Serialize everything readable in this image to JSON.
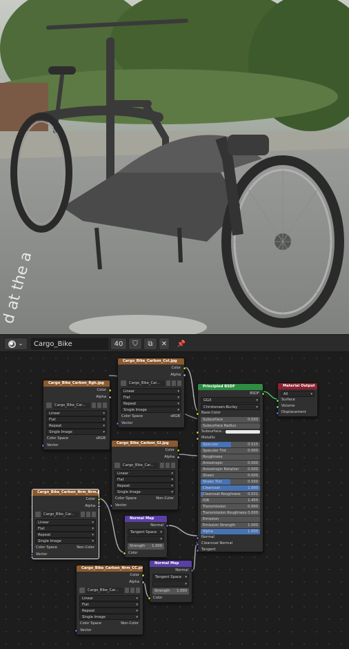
{
  "header": {
    "editor_icon": "shader-editor-icon",
    "material_name": "Cargo_Bike",
    "user_count": "40"
  },
  "viewport": {
    "overlay_text": "d at the a"
  },
  "colors": {
    "texture_header": "#8c5a30",
    "vector_header": "#5b3fa6",
    "shader_header": "#2f8c43",
    "output_header": "#8c2230",
    "color_socket": "#c7c729",
    "float_socket": "#a1a1a1",
    "vector_socket": "#6363c7",
    "shader_socket": "#63c763"
  },
  "tex": {
    "out_color": "Color",
    "out_alpha": "Alpha",
    "opt_interp": "Linear",
    "opt_proj": "Flat",
    "opt_ext": "Repeat",
    "opt_src": "Single Image",
    "cs_label": "Color Space",
    "vector": "Vector",
    "image_name": "Cargo_Bike_Car..."
  },
  "nodes": {
    "rough": {
      "title": "Cargo_Bike_Carbon_Rgh.jpg",
      "cs": "sRGB"
    },
    "col": {
      "title": "Cargo_Bike_Carbon_Col.jpg",
      "cs": "sRGB"
    },
    "gloss": {
      "title": "Cargo_Bike_Carbon_Gl.jpg",
      "cs": "Non-Color"
    },
    "normal": {
      "title": "Cargo_Bike_Carbon_Nrm_Nrm.jpg",
      "cs": "Non-Color"
    },
    "norm2": {
      "title": "Cargo_Bike_Carbon_Nrm_CC.png",
      "cs": "Non-Color"
    },
    "nmap1": {
      "title": "Normal Map",
      "out": "Normal",
      "space": "Tangent Space",
      "strength": "Strength",
      "strength_val": "1.000",
      "in_color": "Color"
    },
    "nmap2": {
      "title": "Normal Map",
      "out": "Normal",
      "space": "Tangent Space",
      "strength": "Strength",
      "strength_val": "1.000",
      "in_color": "Color"
    },
    "bsdf": {
      "title": "Principled BSDF",
      "out": "BSDF",
      "distribution": "GGX",
      "subsurface_method": "Christensen-Burley",
      "base_color": "Base Color",
      "subsurface_color": "Subsurface...",
      "metallic": "Metallic",
      "rows": [
        {
          "label": "Subsurface",
          "value": "0.000",
          "fill": 0
        },
        {
          "label": "Subsurface Radius",
          "value": "",
          "fill": 0
        }
      ],
      "rows2": [
        {
          "label": "Specular",
          "value": "0.515",
          "fill": 0.515
        },
        {
          "label": "Specular Tint",
          "value": "0.000",
          "fill": 0
        },
        {
          "label": "Roughness",
          "value": "",
          "fill": 0
        },
        {
          "label": "Anisotropic",
          "value": "0.000",
          "fill": 0
        },
        {
          "label": "Anisotropic Rotation",
          "value": "0.000",
          "fill": 0
        },
        {
          "label": "Sheen",
          "value": "0.000",
          "fill": 0
        },
        {
          "label": "Sheen Tint",
          "value": "0.500",
          "fill": 0.5
        },
        {
          "label": "Clearcoat",
          "value": "1.000",
          "fill": 1
        },
        {
          "label": "Clearcoat Roughness",
          "value": "0.031",
          "fill": 0.031
        },
        {
          "label": "IOR",
          "value": "1.450",
          "fill": 0
        },
        {
          "label": "Transmission",
          "value": "0.000",
          "fill": 0
        },
        {
          "label": "Transmission Roughness",
          "value": "0.000",
          "fill": 0
        },
        {
          "label": "Emission",
          "value": "",
          "fill": 0
        },
        {
          "label": "Emission Strength",
          "value": "1.000",
          "fill": 0
        },
        {
          "label": "Alpha",
          "value": "1.000",
          "fill": 1
        }
      ],
      "in_normal": "Normal",
      "in_cc_normal": "Clearcoat Normal",
      "in_tangent": "Tangent"
    },
    "output": {
      "title": "Material Output",
      "target": "All",
      "surface": "Surface",
      "volume": "Volume",
      "displacement": "Displacement"
    }
  }
}
